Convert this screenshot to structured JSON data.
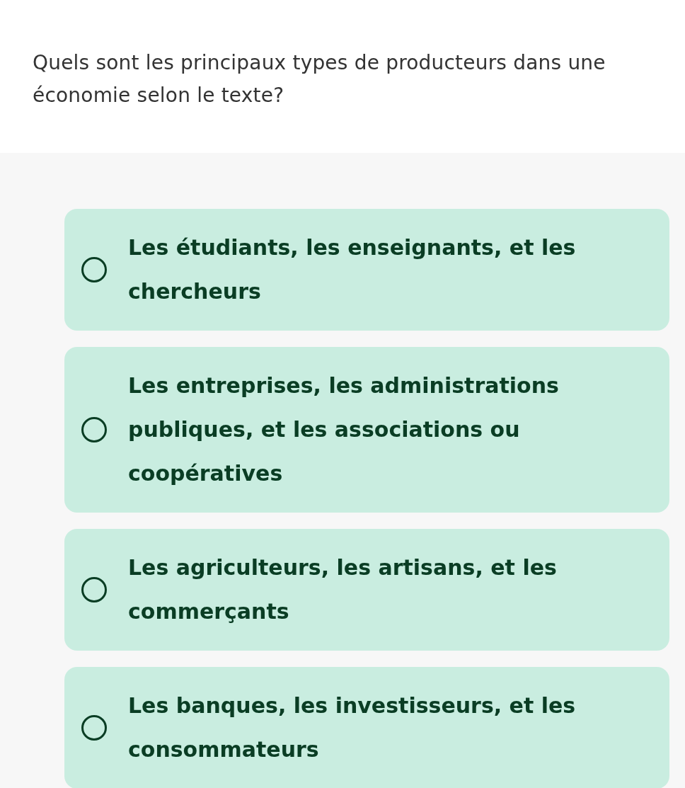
{
  "question": "Quels sont les principaux types de producteurs dans une économie selon le texte?",
  "options": [
    {
      "label": "Les étudiants, les enseignants, et les chercheurs",
      "selected": false
    },
    {
      "label": "Les entreprises, les administrations publiques, et les associations ou coopératives",
      "selected": false
    },
    {
      "label": "Les agriculteurs, les artisans, et les commerçants",
      "selected": false
    },
    {
      "label": "Les banques, les investisseurs, et les consommateurs",
      "selected": false
    }
  ]
}
